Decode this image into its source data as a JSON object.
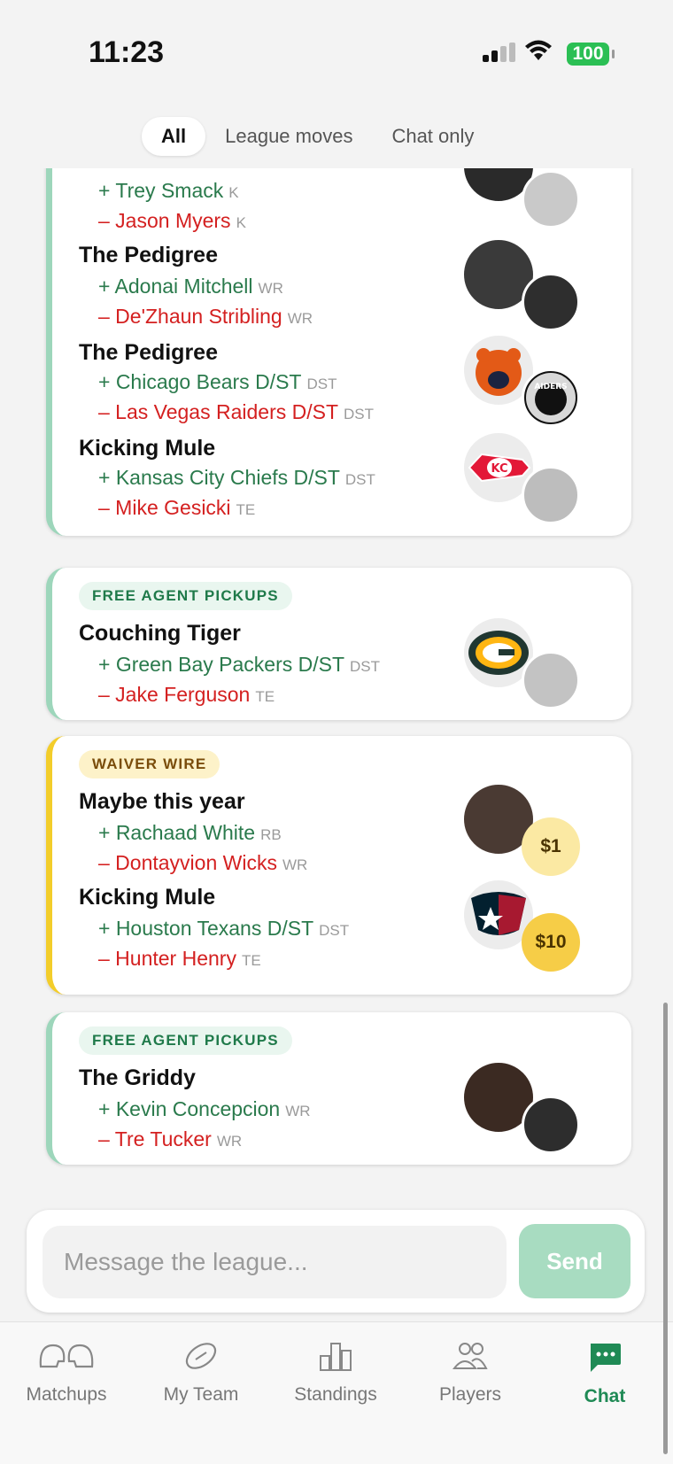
{
  "status": {
    "time": "11:23",
    "battery": "100"
  },
  "filters": {
    "all": "All",
    "league_moves": "League moves",
    "chat_only": "Chat only",
    "selected": "All"
  },
  "cards": [
    {
      "moves": [
        {
          "team": "",
          "add": {
            "name": "+ Trey Smack",
            "pos": "K"
          },
          "drop": {
            "name": "– Jason Myers",
            "pos": "K"
          }
        },
        {
          "team": "The Pedigree",
          "add": {
            "name": "+ Adonai Mitchell",
            "pos": "WR"
          },
          "drop": {
            "name": "– De'Zhaun Stribling",
            "pos": "WR"
          }
        },
        {
          "team": "The Pedigree",
          "add": {
            "name": "+ Chicago Bears D/ST",
            "pos": "DST"
          },
          "drop": {
            "name": "– Las Vegas Raiders D/ST",
            "pos": "DST"
          },
          "logo_text": "AIDERS"
        },
        {
          "team": "Kicking Mule",
          "add": {
            "name": "+ Kansas City Chiefs D/ST",
            "pos": "DST"
          },
          "drop": {
            "name": "– Mike Gesicki",
            "pos": "TE"
          },
          "logo_text": "KC"
        }
      ]
    },
    {
      "tag": "FREE AGENT PICKUPS",
      "moves": [
        {
          "team": "Couching Tiger",
          "add": {
            "name": "+ Green Bay Packers D/ST",
            "pos": "DST"
          },
          "drop": {
            "name": "– Jake Ferguson",
            "pos": "TE"
          }
        }
      ]
    },
    {
      "tag": "WAIVER WIRE",
      "moves": [
        {
          "team": "Maybe this year",
          "add": {
            "name": "+ Rachaad White",
            "pos": "RB"
          },
          "drop": {
            "name": "– Dontayvion Wicks",
            "pos": "WR"
          },
          "bid": "$1"
        },
        {
          "team": "Kicking Mule",
          "add": {
            "name": "+ Houston Texans D/ST",
            "pos": "DST"
          },
          "drop": {
            "name": "– Hunter Henry",
            "pos": "TE"
          },
          "bid": "$10"
        }
      ]
    },
    {
      "tag": "FREE AGENT PICKUPS",
      "moves": [
        {
          "team": "The Griddy",
          "add": {
            "name": "+ Kevin Concepcion",
            "pos": "WR"
          },
          "drop": {
            "name": "– Tre Tucker",
            "pos": "WR"
          }
        }
      ]
    }
  ],
  "composer": {
    "placeholder": "Message the league...",
    "send": "Send"
  },
  "tabs": {
    "matchups": "Matchups",
    "my_team": "My Team",
    "standings": "Standings",
    "players": "Players",
    "chat": "Chat",
    "active": "Chat"
  },
  "colors": {
    "accent": "#1f8a55",
    "add": "#2a7a4c",
    "drop": "#d42020",
    "free_agent_border": "#9dd6bb",
    "waiver_border": "#f3cd2a"
  }
}
